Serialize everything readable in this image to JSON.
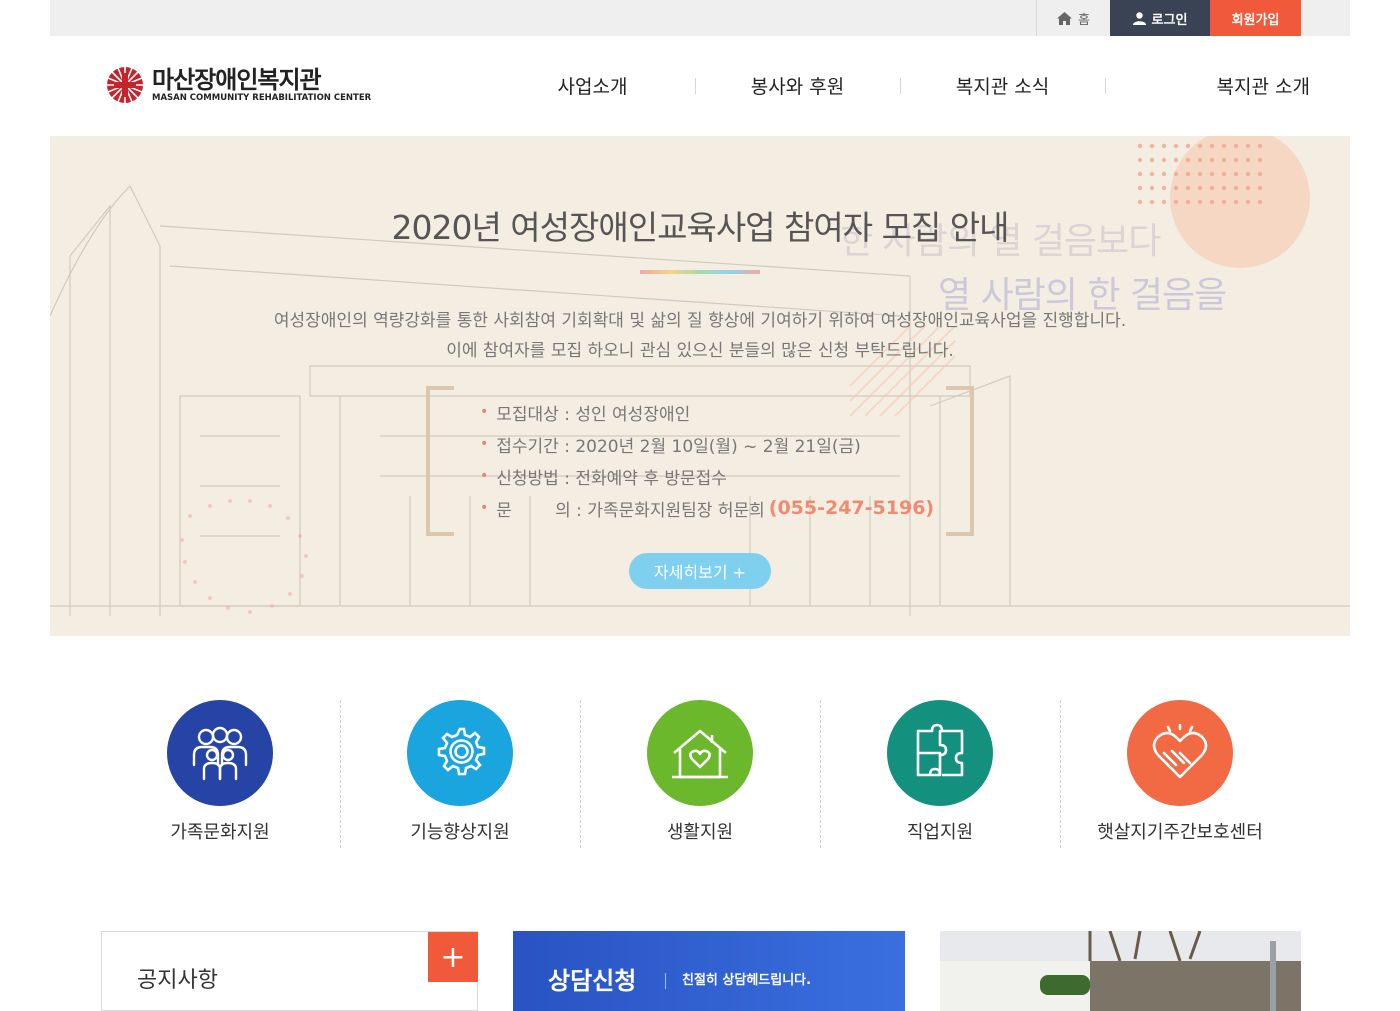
{
  "topbar": {
    "home_label": "홈",
    "login_label": "로그인",
    "join_label": "회원가입"
  },
  "logo": {
    "name_ko": "마산장애인복지관",
    "name_en": "MASAN COMMUNITY REHABILITATION CENTER"
  },
  "nav": [
    {
      "label": "사업소개"
    },
    {
      "label": "봉사와 후원"
    },
    {
      "label": "복지관 소식"
    },
    {
      "label": "복지관 소개"
    }
  ],
  "banner": {
    "title": "2020년 여성장애인교육사업 참여자 모집 안내",
    "desc_line1": "여성장애인의 역량강화를 통한 사회참여 기회확대 및 삶의 질 향상에 기여하기 위하여 여성장애인교육사업을 진행합니다.",
    "desc_line2": "이에 참여자를 모집 하오니 관심 있으신 분들의 많은 신청 부탁드립니다.",
    "slogan_line1": "한 사람의 열 걸음보다",
    "slogan_line2": "열 사람의 한 걸음을",
    "info": [
      {
        "text": "모집대상 : 성인 여성장애인"
      },
      {
        "text": "접수기간 : 2020년 2월 10일(월) ~ 2월 21일(금)"
      },
      {
        "text": "신청방법 : 전화예약 후 방문접수"
      },
      {
        "text": "문        의 : 가족문화지원팀장 허문희"
      }
    ],
    "phone": "(055-247-5196)",
    "more_label": "자세히보기 +"
  },
  "quick_links": [
    {
      "label": "가족문화지원",
      "icon": "family-icon",
      "color": "#2544a6"
    },
    {
      "label": "기능향상지원",
      "icon": "gear-icon",
      "color": "#1aa5de"
    },
    {
      "label": "생활지원",
      "icon": "house-heart-icon",
      "color": "#6cb82c"
    },
    {
      "label": "직업지원",
      "icon": "puzzle-icon",
      "color": "#14907f"
    },
    {
      "label": "햇살지기주간보호센터",
      "icon": "heart-hands-icon",
      "color": "#f26a43"
    }
  ],
  "notice": {
    "title": "공지사항",
    "plus_label": "+"
  },
  "consult": {
    "title": "상담신청",
    "subtitle": "친절히 상담헤드립니다."
  }
}
